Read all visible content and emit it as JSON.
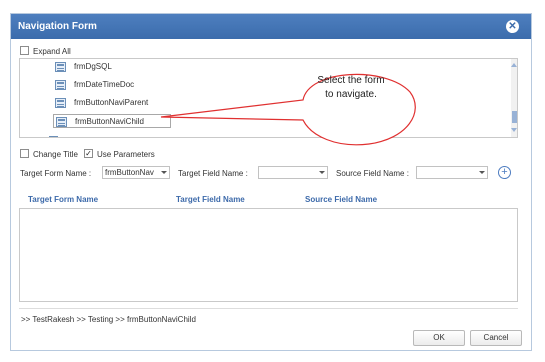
{
  "dialog": {
    "title": "Navigation Form",
    "close_glyph": "✕"
  },
  "expand_all": {
    "label": "Expand All",
    "checked": false
  },
  "tree": {
    "items": [
      {
        "label": "frmDgSQL",
        "icon": "form-icon"
      },
      {
        "label": "frmDateTimeDoc",
        "icon": "form-icon"
      },
      {
        "label": "frmButtonNaviParent",
        "icon": "form-icon"
      },
      {
        "label": "frmButtonNaviChild",
        "icon": "form-icon",
        "selected": true
      }
    ]
  },
  "callout": {
    "line1": "Select the form",
    "line2": "to navigate."
  },
  "options": {
    "change_title": {
      "label": "Change Title",
      "checked": false
    },
    "use_parameters": {
      "label": "Use Parameters",
      "checked": true,
      "check_glyph": "✓"
    }
  },
  "mapping": {
    "target_form_label": "Target Form Name :",
    "target_form_value": "frmButtonNav",
    "target_field_label": "Target Field Name :",
    "target_field_value": "",
    "source_field_label": "Source Field Name :",
    "source_field_value": "",
    "add_glyph": "+"
  },
  "grid": {
    "columns": [
      "Target Form Name",
      "Target Field Name",
      "Source Field Name"
    ],
    "rows": []
  },
  "breadcrumb": ">> TestRakesh >> Testing >> frmButtonNaviChild",
  "buttons": {
    "ok": "OK",
    "cancel": "Cancel"
  },
  "colors": {
    "titlebar": "#3d6cab",
    "accent_text": "#3d6aaa",
    "callout_stroke": "#e03030"
  }
}
